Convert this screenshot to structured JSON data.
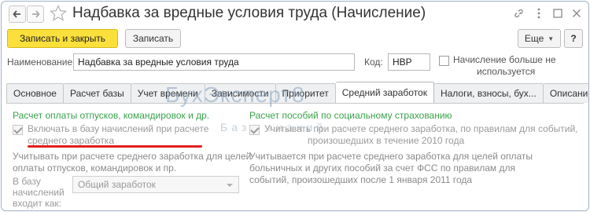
{
  "window": {
    "title": "Надбавка за вредные условия труда (Начисление)"
  },
  "toolbar": {
    "save_close_label": "Записать и закрыть",
    "save_label": "Записать",
    "more_label": "Еще",
    "help_label": "?"
  },
  "header": {
    "name_label": "Наименование:",
    "name_value": "Надбавка за вредные условия труда",
    "code_label": "Код:",
    "code_value": "НВР",
    "not_used_checkbox_label_line1": "Начисление больше не",
    "not_used_checkbox_label_line2": "используется",
    "not_used_checked": false
  },
  "tabs": [
    {
      "label": "Основное",
      "active": false
    },
    {
      "label": "Расчет базы",
      "active": false
    },
    {
      "label": "Учет времени",
      "active": false
    },
    {
      "label": "Зависимости",
      "active": false
    },
    {
      "label": "Приоритет",
      "active": false
    },
    {
      "label": "Средний заработок",
      "active": true
    },
    {
      "label": "Налоги, взносы, бух...",
      "active": false
    },
    {
      "label": "Описание",
      "active": false
    }
  ],
  "watermark": {
    "main": "БухЭксперт8",
    "sub": "База знаний"
  },
  "left_group": {
    "title": "Расчет оплаты отпусков, командировок и др.",
    "checkbox_label_line1": "Включать в базу начислений при расчете",
    "checkbox_label_line2": "среднего заработка",
    "checkbox_checked": true,
    "hint_line1": "Учитывать при расчете среднего заработка для целей",
    "hint_line2": "оплаты отпусков, командировок и пр.",
    "base_label_line1": "В базу",
    "base_label_line2": "начислений",
    "base_label_line3": "входит как:",
    "base_select_value": "Общий заработок"
  },
  "right_group": {
    "title": "Расчет пособий по социальному страхованию",
    "checkbox_label_line1": "Учитывать при расчете среднего заработка, по правилам для событий,",
    "checkbox_label_line2": "произошедших в течение 2010 года",
    "checkbox_checked": true,
    "hint_line1": "Учитывается при расчете среднего заработка для целей оплаты",
    "hint_line2": "больничных и других пособий за счет ФСС по правилам для",
    "hint_line3": "событий, произошедших после 1 января 2011 года"
  },
  "colors": {
    "primary_button": "#fbe03c",
    "group_title": "#3aa24a",
    "underline": "#e2201c"
  }
}
